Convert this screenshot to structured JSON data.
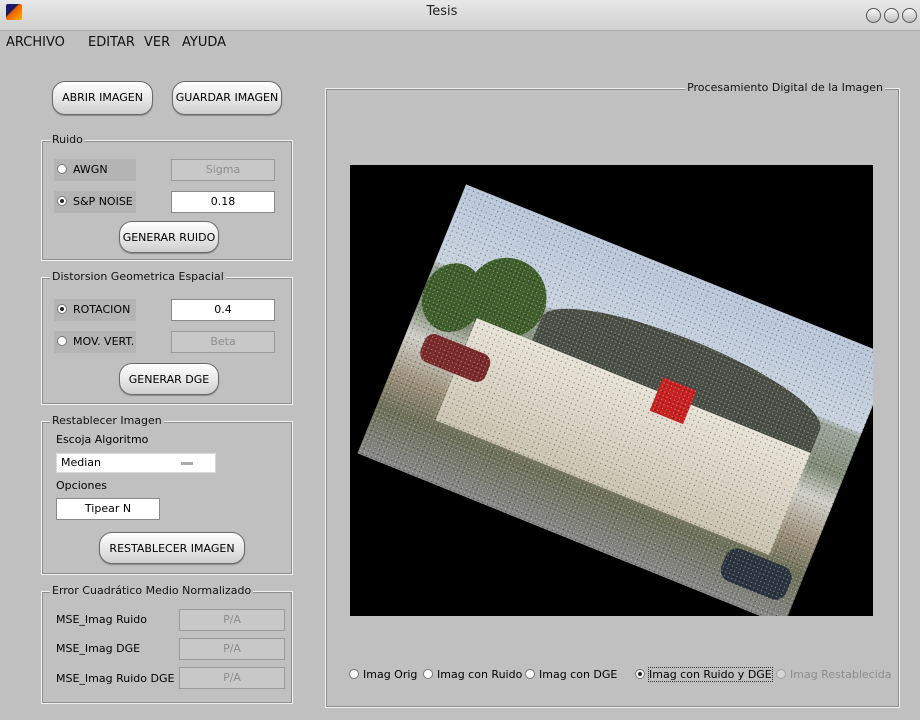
{
  "window": {
    "title": "Tesis"
  },
  "menu": [
    "ARCHIVO",
    "EDITAR",
    "VER",
    "AYUDA"
  ],
  "file_buttons": {
    "open": "ABRIR IMAGEN",
    "save": "GUARDAR IMAGEN"
  },
  "noise": {
    "title": "Ruido",
    "awgn_label": "AWGN",
    "sigma_value": "Sigma",
    "sp_label": "S&P NOISE",
    "sp_value": "0.18",
    "selected": "S&P NOISE",
    "generate_button": "GENERAR RUIDO"
  },
  "distortion": {
    "title": "Distorsion Geometrica Espacial",
    "rotation_label": "ROTACION",
    "rotation_value": "0.4",
    "vertical_label": "MOV. VERT.",
    "beta_value": "Beta",
    "selected": "ROTACION",
    "generate_button": "GENERAR DGE"
  },
  "restore": {
    "title": "Restablecer Imagen",
    "algorithm_label": "Escoja Algoritmo",
    "algorithm_value": "Median",
    "options_label": "Opciones",
    "option_value": "Tipear N",
    "restore_button": "RESTABLECER IMAGEN"
  },
  "mse": {
    "title": "Error Cuadrático Medio Normalizado",
    "rows": [
      {
        "label": "MSE_Imag Ruido",
        "value": "P/A"
      },
      {
        "label": "MSE_Imag DGE",
        "value": "P/A"
      },
      {
        "label": "MSE_Imag Ruido DGE",
        "value": "P/A"
      }
    ]
  },
  "display": {
    "title": "Procesamiento Digital de la Imagen",
    "views": [
      {
        "label": "Imag Orig",
        "selected": false,
        "enabled": true
      },
      {
        "label": "Imag con Ruido",
        "selected": false,
        "enabled": true
      },
      {
        "label": "Imag con DGE",
        "selected": false,
        "enabled": true
      },
      {
        "label": "Imag con Ruido y DGE",
        "selected": true,
        "enabled": true
      },
      {
        "label": "Imag Restablecida",
        "selected": false,
        "enabled": false
      }
    ]
  }
}
